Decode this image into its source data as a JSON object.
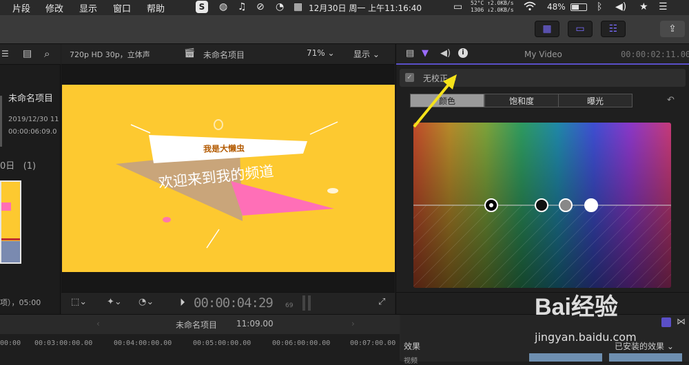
{
  "menubar": {
    "items": [
      "片段",
      "修改",
      "显示",
      "窗口",
      "帮助"
    ],
    "cpu": "52°C",
    "net_up": "↑2.0KB/s",
    "net_fan": "1306",
    "net_down": "↓2.0KB/s",
    "date": "12月30日 周一 上午11:16:40",
    "battery": "48%",
    "icons": [
      "s-app-icon",
      "globe-icon",
      "music-icon",
      "mute-icon",
      "speedometer-icon",
      "calendar-icon",
      "display-icon",
      "wifi-icon",
      "battery-icon",
      "bluetooth-icon",
      "volume-icon",
      "star-icon",
      "menu-list-icon"
    ]
  },
  "browser": {
    "project_title": "未命名项目",
    "project_date": "2019/12/30 11",
    "project_duration": "00:00:06:09.0",
    "group_label": "0日",
    "group_count": "(1)",
    "footer": "项），05:00"
  },
  "viewer": {
    "format": "720p HD 30p，立体声",
    "project_name": "未命名项目",
    "zoom": "71%",
    "display_menu": "显示",
    "canvas": {
      "banner_text": "我是大懒虫",
      "headline": "欢迎来到我的频道",
      "bg_color": "#fdc930"
    },
    "timecode": "00:00:04:29",
    "timecode_frames": "69"
  },
  "inspector": {
    "title": "My Video",
    "duration": "00:00:02:11.00",
    "correction_label": "无校正",
    "tabs": [
      "颜色",
      "饱和度",
      "曝光"
    ],
    "active_tab": 0
  },
  "timeline": {
    "project_name": "未命名项目",
    "duration": "11:09.00",
    "ticks": [
      "00:00",
      "00:03:00:00.00",
      "00:04:00:00.00",
      "00:05:00:00.00",
      "00:06:00:00.00",
      "00:07:00.00"
    ],
    "effects_label": "效果",
    "installed_effects": "已安装的效果",
    "video_label": "视频"
  },
  "watermark": {
    "text": "jingyan.baidu.com",
    "brand": "Bai经验"
  }
}
